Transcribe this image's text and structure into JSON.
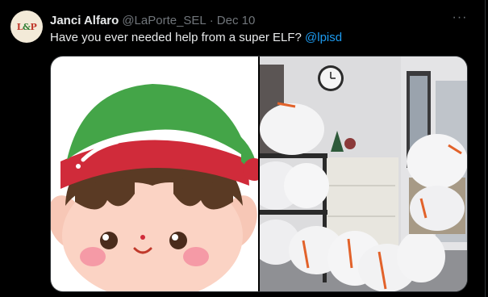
{
  "tweet": {
    "author_name": "Janci Alfaro",
    "handle": "@LaPorte_SEL",
    "separator": "·",
    "date": "Dec 10",
    "text_before": "Have you ever needed help from a super ELF? ",
    "mention": "@lpisd",
    "more_label": "···"
  },
  "avatar": {
    "text_left": "L",
    "text_amp": "&",
    "text_right": "P"
  },
  "media": {
    "left_image": "elf-cartoon-image",
    "right_image": "office-bags-photo"
  },
  "colors": {
    "background": "#000000",
    "text": "#e7e9ea",
    "muted": "#71767b",
    "link": "#1d9bf0"
  }
}
